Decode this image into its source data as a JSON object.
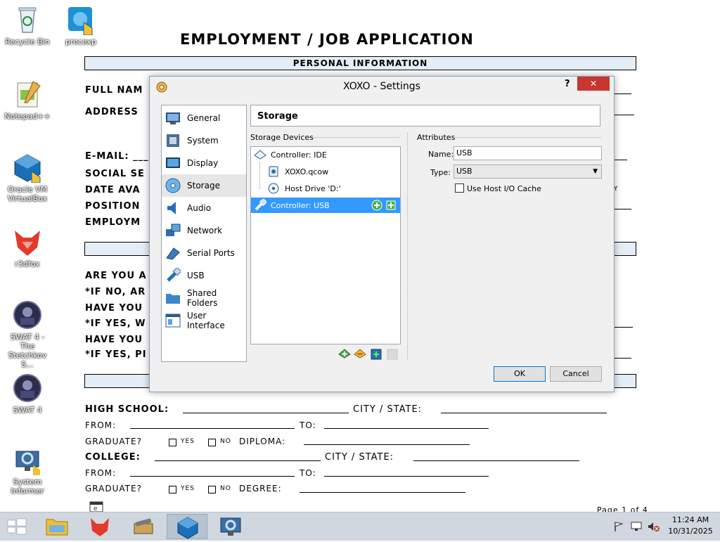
{
  "desktop": {
    "icons": [
      {
        "label": "Recycle Bin",
        "icon": "recycle-bin-icon"
      },
      {
        "label": "procexp",
        "icon": "procexp-icon"
      },
      {
        "label": "Notepad++",
        "icon": "notepad-plus-plus-icon"
      },
      {
        "label": "Oracle VM VirtualBox",
        "icon": "virtualbox-icon"
      },
      {
        "label": "r3dfox",
        "icon": "r3dfox-icon"
      },
      {
        "label": "SWAT 4 - The Stetchkov S...",
        "icon": "swat4-expansion-icon"
      },
      {
        "label": "SWAT 4",
        "icon": "swat4-icon"
      },
      {
        "label": "System Informer",
        "icon": "system-informer-icon"
      }
    ]
  },
  "document": {
    "title": "EMPLOYMENT / JOB APPLICATION",
    "section_personal": "PERSONAL INFORMATION",
    "fields_left": [
      "FULL NAM",
      "ADDRESS",
      "E-MAIL: ___",
      "SOCIAL SE",
      "DATE AVA",
      "POSITION",
      "EMPLOYM"
    ],
    "fields_left2": [
      "ARE YOU A",
      "*IF NO, AR",
      "HAVE YOU",
      "*IF YES, W",
      "HAVE YOU",
      "*IF YES, PI"
    ],
    "right_fragment": "Y",
    "education": {
      "high_school": "HIGH SCHOOL:",
      "city_state": "CITY / STATE:",
      "from": "FROM:",
      "to": "TO:",
      "graduate": "GRADUATE?",
      "yes": "YES",
      "no": "NO",
      "diploma": "DIPLOMA:",
      "college": "COLLEGE:",
      "degree": "DEGREE:"
    },
    "page_indicator": "Page 1 of 4"
  },
  "dialog": {
    "title": "XOXO - Settings",
    "help": "?",
    "close": "✕",
    "nav": [
      {
        "label": "General",
        "icon": "general-icon"
      },
      {
        "label": "System",
        "icon": "system-icon"
      },
      {
        "label": "Display",
        "icon": "display-icon"
      },
      {
        "label": "Storage",
        "icon": "storage-icon",
        "selected": true
      },
      {
        "label": "Audio",
        "icon": "audio-icon"
      },
      {
        "label": "Network",
        "icon": "network-icon"
      },
      {
        "label": "Serial Ports",
        "icon": "serial-ports-icon"
      },
      {
        "label": "USB",
        "icon": "usb-icon"
      },
      {
        "label": "Shared Folders",
        "icon": "shared-folders-icon"
      },
      {
        "label": "User Interface",
        "icon": "user-interface-icon"
      }
    ],
    "section_title": "Storage",
    "storage_devices_label": "Storage Devices",
    "tree": [
      {
        "label": "Controller: IDE",
        "icon": "ide-controller-icon",
        "level": 0
      },
      {
        "label": "XOXO.qcow",
        "icon": "hard-disk-icon",
        "level": 1
      },
      {
        "label": "Host Drive 'D:'",
        "icon": "optical-drive-icon",
        "level": 1
      },
      {
        "label": "Controller: USB",
        "icon": "usb-controller-icon",
        "level": 0,
        "selected": true
      }
    ],
    "attributes_label": "Attributes",
    "name_label": "Name:",
    "name_value": "USB",
    "type_label": "Type:",
    "type_value": "USB",
    "cache_label": "Use Host I/O Cache",
    "cache_checked": false,
    "ok": "OK",
    "cancel": "Cancel"
  },
  "taskbar": {
    "apps": [
      {
        "icon": "start-icon"
      },
      {
        "icon": "file-explorer-icon"
      },
      {
        "icon": "r3dfox-icon"
      },
      {
        "icon": "folder-books-icon"
      },
      {
        "icon": "virtualbox-icon",
        "active": true
      },
      {
        "icon": "system-informer-icon"
      }
    ],
    "time": "11:24 AM",
    "date": "10/31/2025"
  },
  "colors": {
    "selection": "#3399ff",
    "close_button": "#c7372f",
    "section_bar": "#e4eef7",
    "taskbar": "#d0d7df"
  }
}
